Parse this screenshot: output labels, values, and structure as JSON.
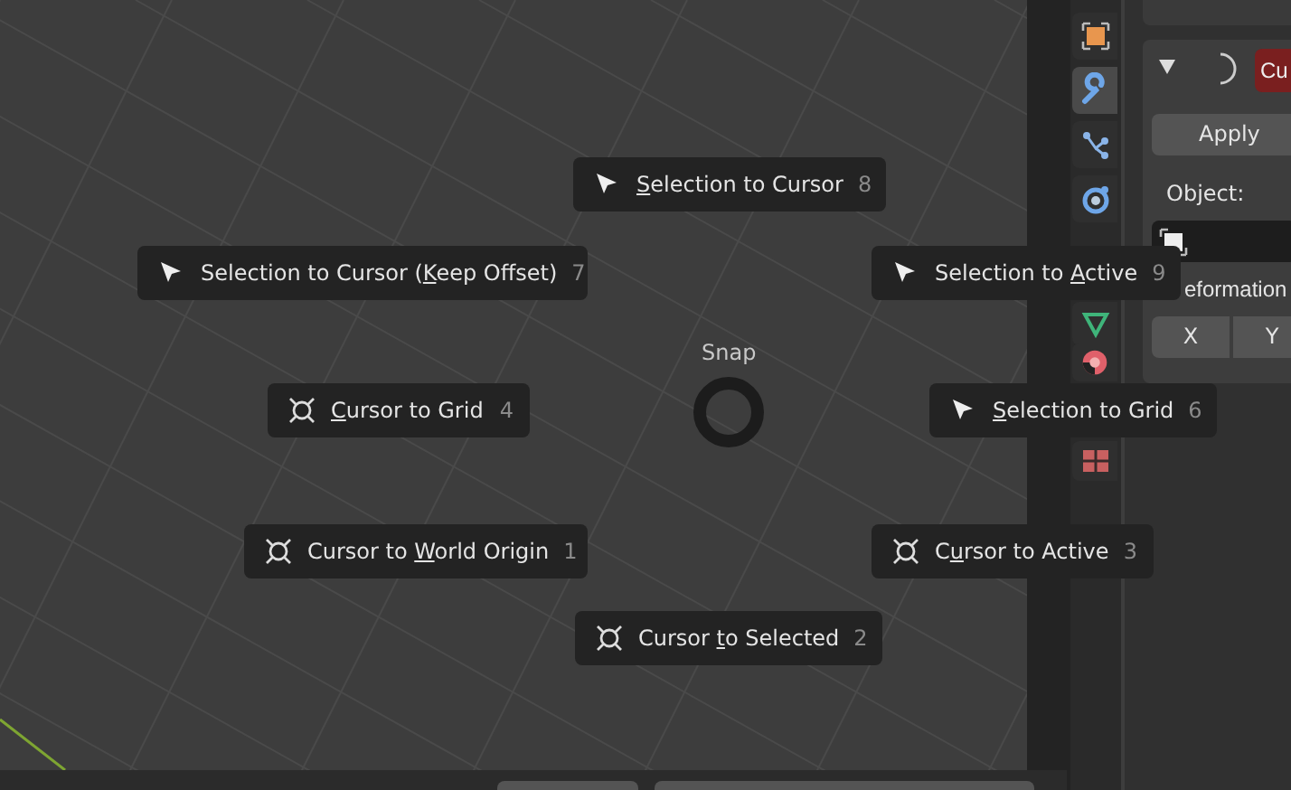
{
  "pie_menu": {
    "title": "Snap",
    "items": [
      {
        "kind": "selection",
        "accelerator": "S",
        "label_after": "election to Cursor",
        "number": "8"
      },
      {
        "kind": "selection",
        "label_before": "Selection to Cursor (",
        "accelerator": "K",
        "label_after": "eep Offset)",
        "number": "7"
      },
      {
        "kind": "selection",
        "label_before": "Selection to ",
        "accelerator": "A",
        "label_after": "ctive",
        "number": "9"
      },
      {
        "kind": "cursor",
        "accelerator": "C",
        "label_after": "ursor to Grid",
        "number": "4"
      },
      {
        "kind": "selection",
        "accelerator": "S",
        "label_after": "election to Grid",
        "number": "6"
      },
      {
        "kind": "cursor",
        "label_before": "Cursor to ",
        "accelerator": "W",
        "label_after": "orld Origin",
        "number": "1"
      },
      {
        "kind": "cursor",
        "label_before": "C",
        "accelerator": "u",
        "label_after": "rsor to Active",
        "number": "3"
      },
      {
        "kind": "cursor",
        "label_before": "Cursor ",
        "accelerator": "t",
        "label_after": "o Selected",
        "number": "2"
      }
    ]
  },
  "properties_tabs": [
    {
      "kind": "object",
      "selected": false
    },
    {
      "kind": "modifier",
      "selected": true
    },
    {
      "kind": "particles",
      "selected": false
    },
    {
      "kind": "physics",
      "selected": false
    },
    {
      "kind": "data",
      "selected": false
    },
    {
      "kind": "material",
      "selected": false
    },
    {
      "kind": "texture",
      "selected": false
    }
  ],
  "modifier_panel": {
    "name_button": "Cu",
    "apply_button": "Apply",
    "object_label": "Object:",
    "section_label": "eformation",
    "axis_buttons": [
      "X",
      "Y"
    ]
  }
}
